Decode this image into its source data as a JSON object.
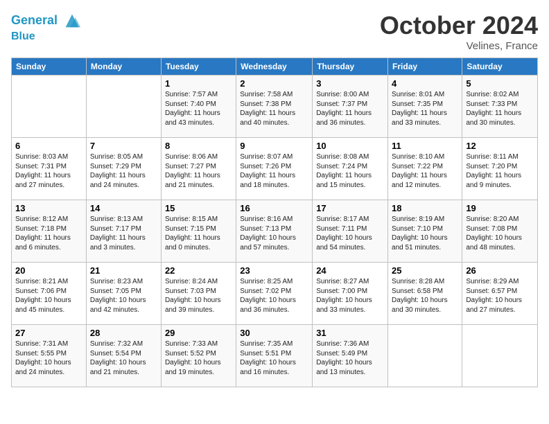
{
  "header": {
    "logo_line1": "General",
    "logo_line2": "Blue",
    "month": "October 2024",
    "location": "Velines, France"
  },
  "weekdays": [
    "Sunday",
    "Monday",
    "Tuesday",
    "Wednesday",
    "Thursday",
    "Friday",
    "Saturday"
  ],
  "weeks": [
    [
      {
        "day": "",
        "sunrise": "",
        "sunset": "",
        "daylight": ""
      },
      {
        "day": "",
        "sunrise": "",
        "sunset": "",
        "daylight": ""
      },
      {
        "day": "1",
        "sunrise": "Sunrise: 7:57 AM",
        "sunset": "Sunset: 7:40 PM",
        "daylight": "Daylight: 11 hours and 43 minutes."
      },
      {
        "day": "2",
        "sunrise": "Sunrise: 7:58 AM",
        "sunset": "Sunset: 7:38 PM",
        "daylight": "Daylight: 11 hours and 40 minutes."
      },
      {
        "day": "3",
        "sunrise": "Sunrise: 8:00 AM",
        "sunset": "Sunset: 7:37 PM",
        "daylight": "Daylight: 11 hours and 36 minutes."
      },
      {
        "day": "4",
        "sunrise": "Sunrise: 8:01 AM",
        "sunset": "Sunset: 7:35 PM",
        "daylight": "Daylight: 11 hours and 33 minutes."
      },
      {
        "day": "5",
        "sunrise": "Sunrise: 8:02 AM",
        "sunset": "Sunset: 7:33 PM",
        "daylight": "Daylight: 11 hours and 30 minutes."
      }
    ],
    [
      {
        "day": "6",
        "sunrise": "Sunrise: 8:03 AM",
        "sunset": "Sunset: 7:31 PM",
        "daylight": "Daylight: 11 hours and 27 minutes."
      },
      {
        "day": "7",
        "sunrise": "Sunrise: 8:05 AM",
        "sunset": "Sunset: 7:29 PM",
        "daylight": "Daylight: 11 hours and 24 minutes."
      },
      {
        "day": "8",
        "sunrise": "Sunrise: 8:06 AM",
        "sunset": "Sunset: 7:27 PM",
        "daylight": "Daylight: 11 hours and 21 minutes."
      },
      {
        "day": "9",
        "sunrise": "Sunrise: 8:07 AM",
        "sunset": "Sunset: 7:26 PM",
        "daylight": "Daylight: 11 hours and 18 minutes."
      },
      {
        "day": "10",
        "sunrise": "Sunrise: 8:08 AM",
        "sunset": "Sunset: 7:24 PM",
        "daylight": "Daylight: 11 hours and 15 minutes."
      },
      {
        "day": "11",
        "sunrise": "Sunrise: 8:10 AM",
        "sunset": "Sunset: 7:22 PM",
        "daylight": "Daylight: 11 hours and 12 minutes."
      },
      {
        "day": "12",
        "sunrise": "Sunrise: 8:11 AM",
        "sunset": "Sunset: 7:20 PM",
        "daylight": "Daylight: 11 hours and 9 minutes."
      }
    ],
    [
      {
        "day": "13",
        "sunrise": "Sunrise: 8:12 AM",
        "sunset": "Sunset: 7:18 PM",
        "daylight": "Daylight: 11 hours and 6 minutes."
      },
      {
        "day": "14",
        "sunrise": "Sunrise: 8:13 AM",
        "sunset": "Sunset: 7:17 PM",
        "daylight": "Daylight: 11 hours and 3 minutes."
      },
      {
        "day": "15",
        "sunrise": "Sunrise: 8:15 AM",
        "sunset": "Sunset: 7:15 PM",
        "daylight": "Daylight: 11 hours and 0 minutes."
      },
      {
        "day": "16",
        "sunrise": "Sunrise: 8:16 AM",
        "sunset": "Sunset: 7:13 PM",
        "daylight": "Daylight: 10 hours and 57 minutes."
      },
      {
        "day": "17",
        "sunrise": "Sunrise: 8:17 AM",
        "sunset": "Sunset: 7:11 PM",
        "daylight": "Daylight: 10 hours and 54 minutes."
      },
      {
        "day": "18",
        "sunrise": "Sunrise: 8:19 AM",
        "sunset": "Sunset: 7:10 PM",
        "daylight": "Daylight: 10 hours and 51 minutes."
      },
      {
        "day": "19",
        "sunrise": "Sunrise: 8:20 AM",
        "sunset": "Sunset: 7:08 PM",
        "daylight": "Daylight: 10 hours and 48 minutes."
      }
    ],
    [
      {
        "day": "20",
        "sunrise": "Sunrise: 8:21 AM",
        "sunset": "Sunset: 7:06 PM",
        "daylight": "Daylight: 10 hours and 45 minutes."
      },
      {
        "day": "21",
        "sunrise": "Sunrise: 8:23 AM",
        "sunset": "Sunset: 7:05 PM",
        "daylight": "Daylight: 10 hours and 42 minutes."
      },
      {
        "day": "22",
        "sunrise": "Sunrise: 8:24 AM",
        "sunset": "Sunset: 7:03 PM",
        "daylight": "Daylight: 10 hours and 39 minutes."
      },
      {
        "day": "23",
        "sunrise": "Sunrise: 8:25 AM",
        "sunset": "Sunset: 7:02 PM",
        "daylight": "Daylight: 10 hours and 36 minutes."
      },
      {
        "day": "24",
        "sunrise": "Sunrise: 8:27 AM",
        "sunset": "Sunset: 7:00 PM",
        "daylight": "Daylight: 10 hours and 33 minutes."
      },
      {
        "day": "25",
        "sunrise": "Sunrise: 8:28 AM",
        "sunset": "Sunset: 6:58 PM",
        "daylight": "Daylight: 10 hours and 30 minutes."
      },
      {
        "day": "26",
        "sunrise": "Sunrise: 8:29 AM",
        "sunset": "Sunset: 6:57 PM",
        "daylight": "Daylight: 10 hours and 27 minutes."
      }
    ],
    [
      {
        "day": "27",
        "sunrise": "Sunrise: 7:31 AM",
        "sunset": "Sunset: 5:55 PM",
        "daylight": "Daylight: 10 hours and 24 minutes."
      },
      {
        "day": "28",
        "sunrise": "Sunrise: 7:32 AM",
        "sunset": "Sunset: 5:54 PM",
        "daylight": "Daylight: 10 hours and 21 minutes."
      },
      {
        "day": "29",
        "sunrise": "Sunrise: 7:33 AM",
        "sunset": "Sunset: 5:52 PM",
        "daylight": "Daylight: 10 hours and 19 minutes."
      },
      {
        "day": "30",
        "sunrise": "Sunrise: 7:35 AM",
        "sunset": "Sunset: 5:51 PM",
        "daylight": "Daylight: 10 hours and 16 minutes."
      },
      {
        "day": "31",
        "sunrise": "Sunrise: 7:36 AM",
        "sunset": "Sunset: 5:49 PM",
        "daylight": "Daylight: 10 hours and 13 minutes."
      },
      {
        "day": "",
        "sunrise": "",
        "sunset": "",
        "daylight": ""
      },
      {
        "day": "",
        "sunrise": "",
        "sunset": "",
        "daylight": ""
      }
    ]
  ]
}
